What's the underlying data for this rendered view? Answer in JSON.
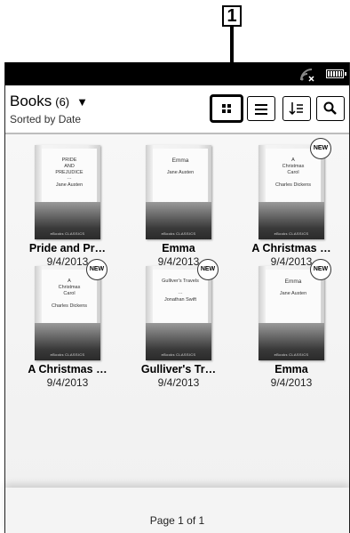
{
  "callout": {
    "number": "1"
  },
  "header": {
    "title": "Books",
    "count": "(6)",
    "subtitle": "Sorted by Date"
  },
  "toolbar": {
    "grid_view": "grid-view-icon",
    "list_view": "list-view-icon",
    "sort": "sort-icon",
    "search": "search-icon"
  },
  "books": [
    {
      "title": "Pride and Pr…",
      "date": "9/4/2013",
      "new": false,
      "cover": [
        "PRIDE",
        "AND",
        "PREJUDICE",
        "···",
        "Jane Austen"
      ]
    },
    {
      "title": "Emma",
      "date": "9/4/2013",
      "new": false,
      "cover": [
        "Emma",
        "Jane Austen"
      ]
    },
    {
      "title": "A Christmas …",
      "date": "9/4/2013",
      "new": true,
      "cover": [
        "A",
        "Christmas",
        "Carol",
        "Charles Dickens"
      ]
    },
    {
      "title": "A Christmas …",
      "date": "9/4/2013",
      "new": true,
      "cover": [
        "A",
        "Christmas",
        "Carol",
        "Charles Dickens"
      ]
    },
    {
      "title": "Gulliver's Tr…",
      "date": "9/4/2013",
      "new": true,
      "cover": [
        "Gulliver's Travels",
        "···",
        "Jonathan Swift"
      ]
    },
    {
      "title": "Emma",
      "date": "9/4/2013",
      "new": true,
      "cover": [
        "Emma",
        "Jane Austen"
      ]
    }
  ],
  "badge_label": "NEW",
  "cover_brand": "eBooks CLASSICS",
  "footer": {
    "page": "Page 1 of 1"
  }
}
